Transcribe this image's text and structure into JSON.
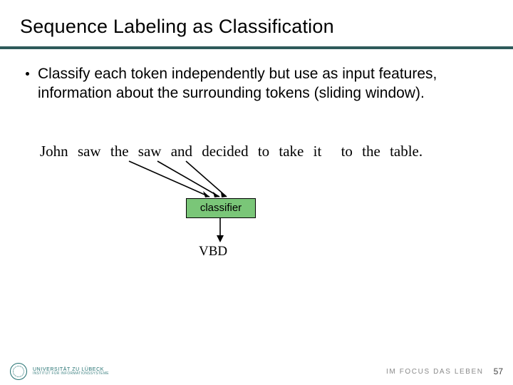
{
  "title": "Sequence Labeling as Classification",
  "bullet": "Classify each token independently but use as input features, information about the surrounding tokens (sliding window).",
  "sentence": {
    "tokens": [
      "John",
      "saw",
      "the",
      "saw",
      "and",
      "decided",
      "to",
      "take",
      "it",
      "to",
      "the",
      "table."
    ]
  },
  "classifier_label": "classifier",
  "output_tag": "VBD",
  "diagram": {
    "window_center_token_index": 3,
    "window_tokens": [
      "the",
      "saw",
      "and"
    ],
    "arrows_into_classifier_from_tokens": [
      "the",
      "saw",
      "and"
    ],
    "arrow_out_label": "VBD"
  },
  "footer": {
    "university_line1": "UNIVERSITÄT ZU LÜBECK",
    "university_line2": "INSTITUT FÜR INFORMATIONSSYSTEME",
    "tagline": "IM FOCUS DAS LEBEN",
    "page": "57"
  }
}
